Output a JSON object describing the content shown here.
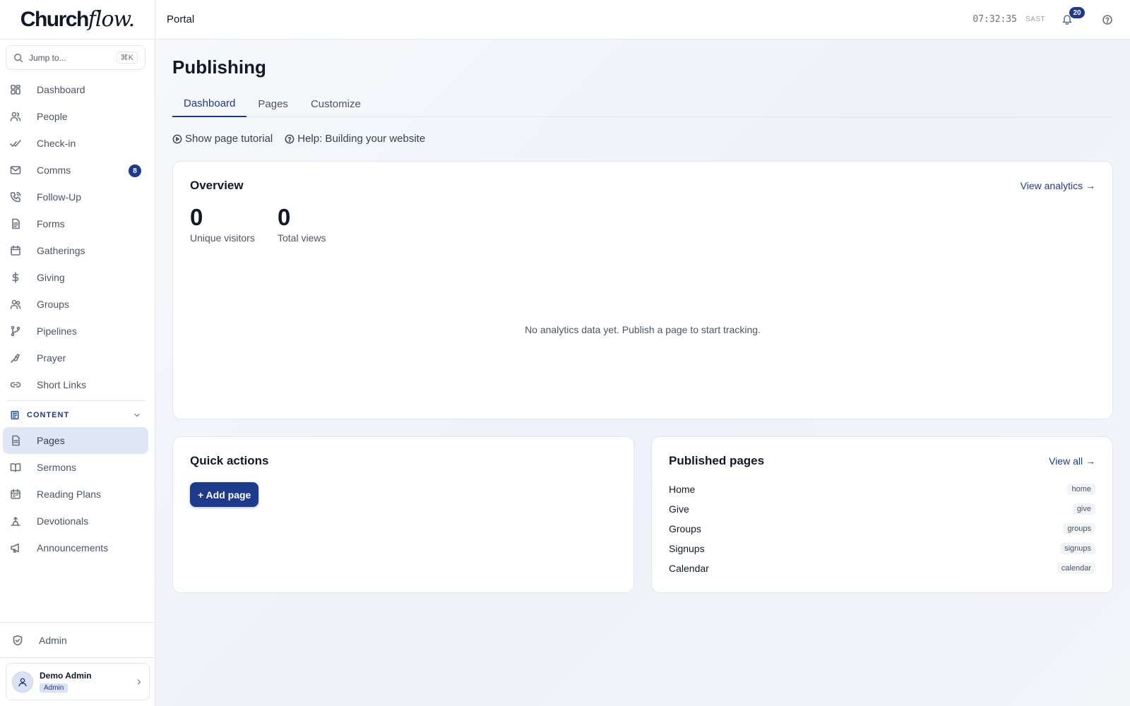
{
  "app": {
    "logo_main": "Church",
    "logo_accent": "flow."
  },
  "search": {
    "placeholder": "Jump to...",
    "shortcut": "⌘K"
  },
  "sidebar": {
    "items": [
      {
        "label": "Dashboard",
        "icon": "dashboard-icon"
      },
      {
        "label": "People",
        "icon": "people-icon"
      },
      {
        "label": "Check-in",
        "icon": "check-icon"
      },
      {
        "label": "Comms",
        "icon": "mail-icon",
        "badge": "8"
      },
      {
        "label": "Follow-Up",
        "icon": "phone-icon"
      },
      {
        "label": "Forms",
        "icon": "form-icon"
      },
      {
        "label": "Gatherings",
        "icon": "calendar-icon"
      },
      {
        "label": "Giving",
        "icon": "dollar-icon"
      },
      {
        "label": "Groups",
        "icon": "groups-icon"
      },
      {
        "label": "Pipelines",
        "icon": "pipeline-icon"
      },
      {
        "label": "Prayer",
        "icon": "prayer-icon"
      },
      {
        "label": "Short Links",
        "icon": "link-icon"
      }
    ],
    "section_title": "CONTENT",
    "content_items": [
      {
        "label": "Pages",
        "icon": "page-icon",
        "active": true
      },
      {
        "label": "Sermons",
        "icon": "book-icon"
      },
      {
        "label": "Reading Plans",
        "icon": "calendar-icon"
      },
      {
        "label": "Devotionals",
        "icon": "devotional-icon"
      },
      {
        "label": "Announcements",
        "icon": "megaphone-icon"
      }
    ],
    "admin_label": "Admin",
    "user": {
      "name": "Demo Admin",
      "role": "Admin"
    }
  },
  "header": {
    "breadcrumb": "Portal",
    "time": "07:32:35",
    "timezone": "SAST",
    "notifications": "20"
  },
  "main": {
    "title": "Publishing",
    "tabs": [
      {
        "label": "Dashboard",
        "active": true
      },
      {
        "label": "Pages"
      },
      {
        "label": "Customize"
      }
    ],
    "tutorial_link": "Show page tutorial",
    "help_link": "Help: Building your website",
    "overview": {
      "title": "Overview",
      "analytics_link": "View analytics →",
      "unique_visitors": {
        "value": "0",
        "label": "Unique visitors"
      },
      "total_views": {
        "value": "0",
        "label": "Total views"
      },
      "empty_message": "No analytics data yet. Publish a page to start tracking."
    },
    "quick_actions": {
      "title": "Quick actions",
      "add_page": "+ Add page"
    },
    "published_pages": {
      "title": "Published pages",
      "view_all": "View all →",
      "pages": [
        {
          "name": "Home",
          "slug": "home"
        },
        {
          "name": "Give",
          "slug": "give"
        },
        {
          "name": "Groups",
          "slug": "groups"
        },
        {
          "name": "Signups",
          "slug": "signups"
        },
        {
          "name": "Calendar",
          "slug": "calendar"
        }
      ]
    }
  },
  "colors": {
    "accent": "#1e3a8a",
    "active_bg": "#dfe6f5"
  }
}
